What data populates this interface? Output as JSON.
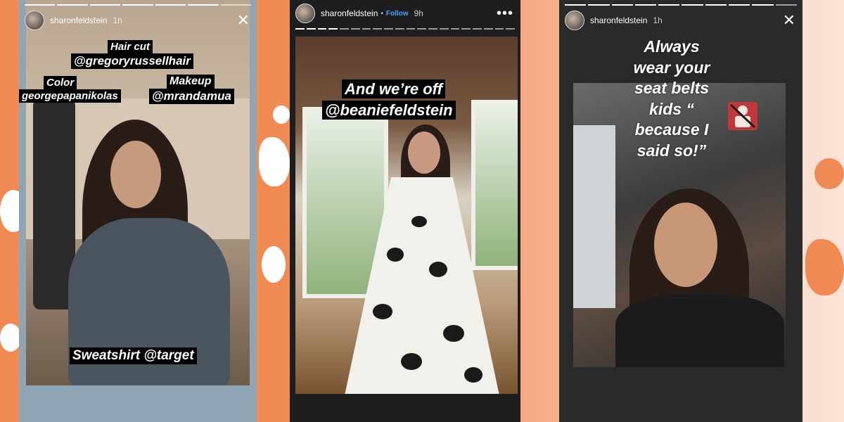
{
  "colors": {
    "background": "#f08a55",
    "accent_follow": "#4aa3ff",
    "tag_bg": "#000000",
    "tag_text": "#ffffff"
  },
  "stories": [
    {
      "username": "sharonfeldstein",
      "time": "1h",
      "icon": "close-icon",
      "tags": {
        "haircut_label": "Hair cut",
        "haircut_handle": "@gregoryrussellhair",
        "color_label": "Color",
        "color_handle": "georgepapanikolas",
        "makeup_label": "Makeup",
        "makeup_handle": "@mrandamua",
        "sweatshirt": "Sweatshirt @target"
      }
    },
    {
      "username": "sharonfeldstein",
      "follow": "Follow",
      "time": "9h",
      "icon": "more-icon",
      "tags": {
        "line1": "And we’re off",
        "line2": "@beaniefeldstein"
      }
    },
    {
      "username": "sharonfeldstein",
      "time": "1h",
      "icon": "close-icon",
      "caption": {
        "line1": "Always",
        "line2": "wear your",
        "line3": "seat belts",
        "line4": "kids “",
        "line5": "because I",
        "line6": "said so!”"
      }
    }
  ]
}
